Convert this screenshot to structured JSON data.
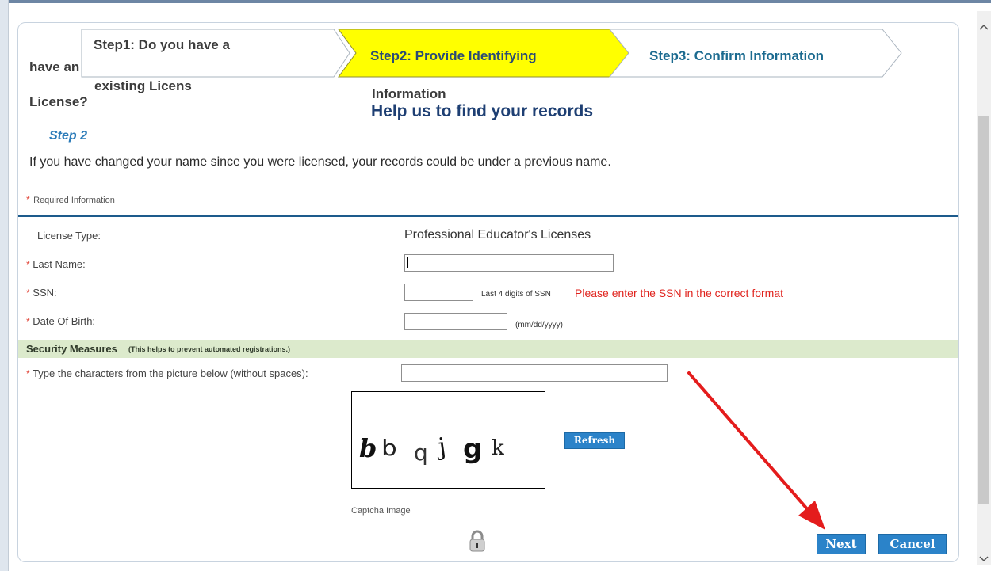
{
  "wizard": {
    "step1_line1": "Step1: Do you have a",
    "step1_line2": "existing Licens",
    "step1_overflow_a": "have an",
    "step1_overflow_b": "License?",
    "step2_line1": "Step2: Provide Identifying",
    "step2_line2": "Information",
    "step3": "Step3: Confirm Information",
    "colors": {
      "active_step": "#ffff00",
      "step3_text": "#1c6b90"
    }
  },
  "page": {
    "heading": "Help us to find your records",
    "step_label": "Step 2",
    "intro": "If you have changed your name since you were licensed, your records could be under a previous name.",
    "required_star": "*",
    "required_note": "Required Information"
  },
  "form": {
    "license_type_label": "License Type:",
    "license_type_value": "Professional Educator's Licenses",
    "last_name_label": "Last Name:",
    "last_name_value": "",
    "ssn_label": "SSN:",
    "ssn_value": "",
    "ssn_hint": "Last 4 digits of SSN",
    "ssn_error": "Please enter the SSN in the correct format",
    "dob_label": "Date Of Birth:",
    "dob_value": "",
    "dob_hint": "(mm/dd/yyyy)"
  },
  "security": {
    "title": "Security Measures",
    "subtitle": "(This helps to prevent automated registrations.)",
    "prompt": "Type the characters from the picture below (without spaces):",
    "captcha_value": "",
    "captcha_text": "bbqjgk",
    "refresh_label": "Refresh",
    "captcha_caption": "Captcha Image"
  },
  "actions": {
    "next_label": "Next",
    "cancel_label": "Cancel"
  }
}
